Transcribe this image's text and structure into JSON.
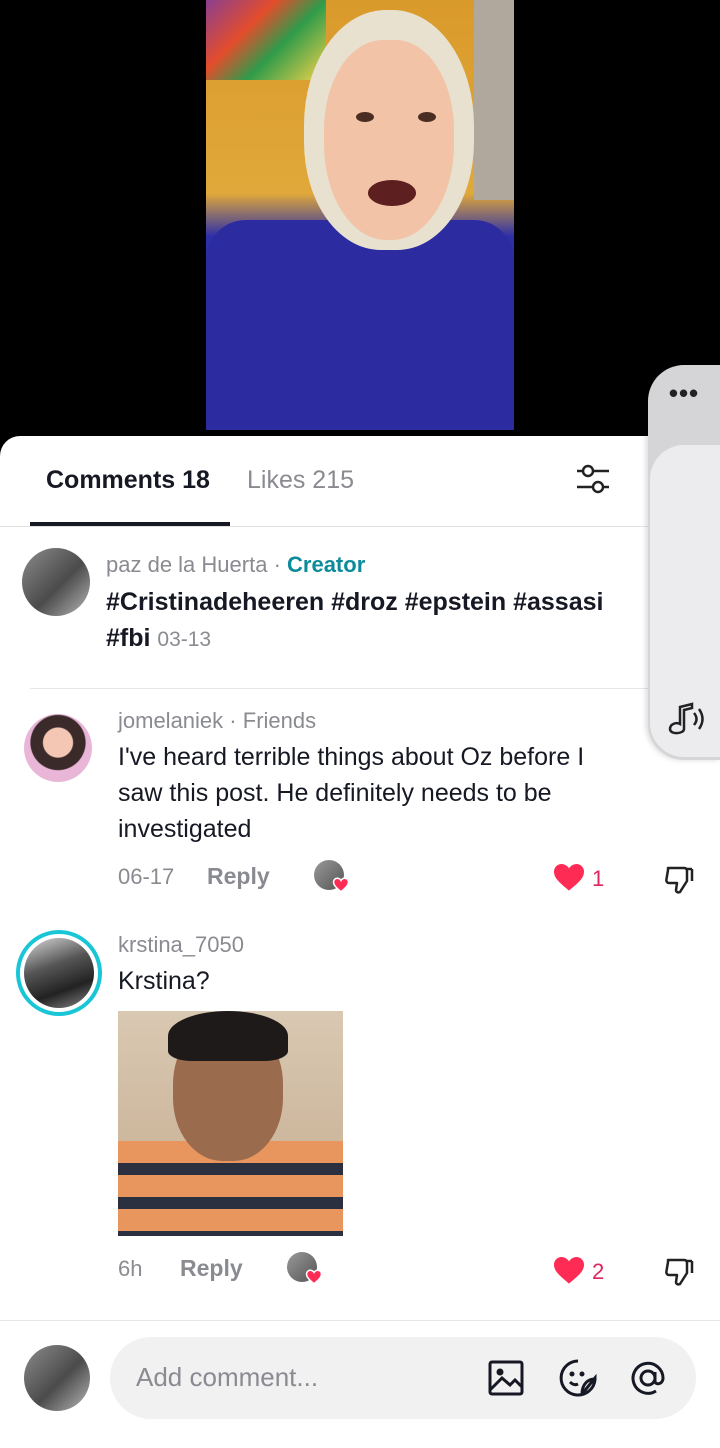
{
  "tabs": {
    "comments_label": "Comments 18",
    "likes_label": "Likes 215"
  },
  "comments": [
    {
      "username": "paz de la Huerta",
      "separator": "·",
      "badge": "Creator",
      "text_line1": "#Cristinadeheeren #droz #epstein #assasi",
      "text_line2": "#fbi",
      "timestamp": "03-13"
    },
    {
      "username": "jomelaniek",
      "separator": "·",
      "badge": "Friends",
      "text_line1": "I've heard terrible things about Oz before I",
      "text_line2": "saw this post. He definitely needs to be",
      "text_line3": "investigated",
      "timestamp": "06-17",
      "reply_label": "Reply",
      "like_count": "1"
    },
    {
      "username": "krstina_7050",
      "text_line1": "Krstina?",
      "timestamp": "6h",
      "reply_label": "Reply",
      "like_count": "2"
    }
  ],
  "composer": {
    "placeholder": "Add comment..."
  },
  "side_panel": {
    "more_label": "•••"
  },
  "colors": {
    "accent_creator": "#0e8b9a",
    "like_red": "#fe2c55",
    "story_ring": "#19c6d6"
  },
  "icons": [
    "filter-icon",
    "more-icon",
    "sound-icon",
    "heart-icon",
    "dislike-icon",
    "image-icon",
    "sticker-icon",
    "mention-icon"
  ]
}
